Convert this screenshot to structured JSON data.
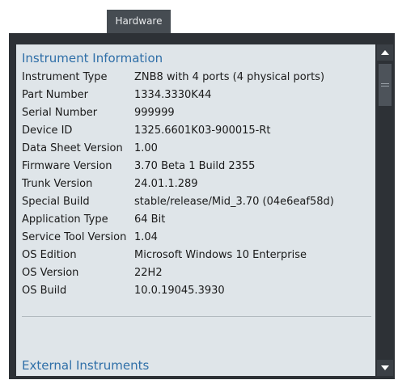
{
  "tab": {
    "label": "Hardware"
  },
  "sections": {
    "instrument_title": "Instrument Information",
    "external_title": "External Instruments"
  },
  "instrument_info": [
    {
      "key": "Instrument Type",
      "value": "ZNB8 with 4 ports (4 physical ports)"
    },
    {
      "key": "Part Number",
      "value": "1334.3330K44"
    },
    {
      "key": "Serial Number",
      "value": "999999"
    },
    {
      "key": "Device ID",
      "value": "1325.6601K03-900015-Rt"
    },
    {
      "key": "Data Sheet Version",
      "value": "1.00"
    },
    {
      "key": "Firmware Version",
      "value": "3.70 Beta 1 Build 2355"
    },
    {
      "key": "Trunk Version",
      "value": "24.01.1.289"
    },
    {
      "key": "Special Build",
      "value": "stable/release/Mid_3.70 (04e6eaf58d)"
    },
    {
      "key": "Application Type",
      "value": "64 Bit"
    },
    {
      "key": "Service Tool Version",
      "value": "1.04"
    },
    {
      "key": "OS Edition",
      "value": "Microsoft Windows 10 Enterprise"
    },
    {
      "key": "OS Version",
      "value": "22H2"
    },
    {
      "key": "OS Build",
      "value": "10.0.19045.3930"
    }
  ],
  "scrollbar": {
    "up_icon": "triangle-up",
    "down_icon": "triangle-down",
    "thumb_icon": "grip-lines"
  },
  "colors": {
    "frame": "#2d3136",
    "tab": "#464c52",
    "content_bg": "#dfe5e9",
    "section_title": "#2f6fa8"
  }
}
